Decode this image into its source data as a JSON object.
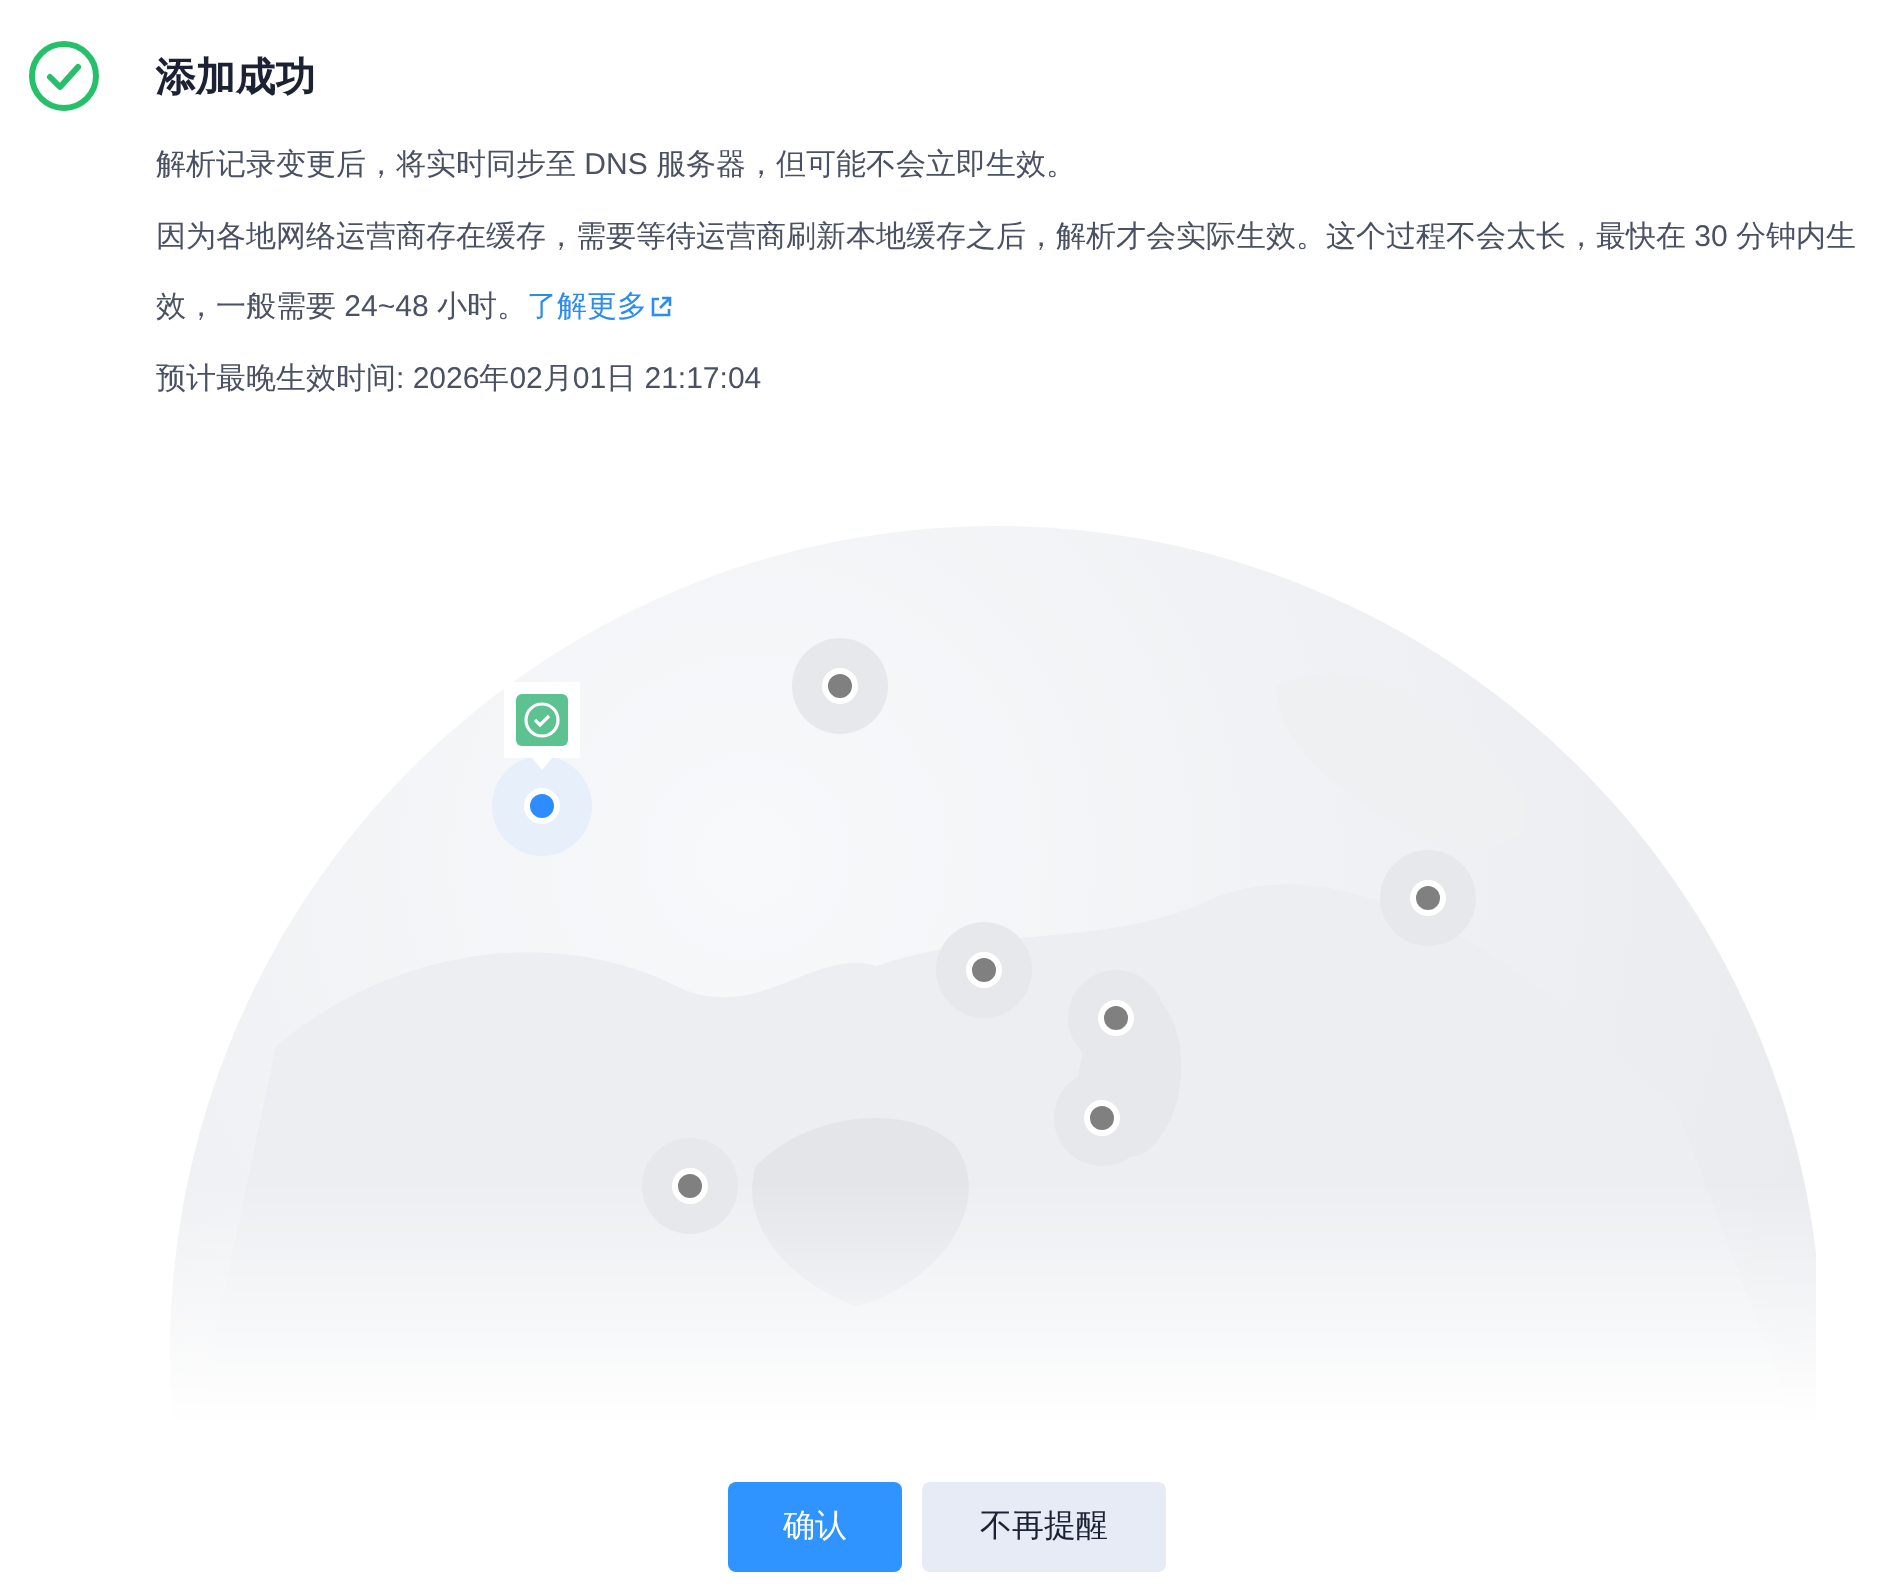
{
  "title": "添加成功",
  "notes": [
    {
      "text": "解析记录变更后，将实时同步至 DNS 服务器，但可能不会立即生效。"
    },
    {
      "text": "因为各地网络运营商存在缓存，需要等待运营商刷新本地缓存之后，解析才会实际生效。这个过程不会太长，最快在 30 分钟内生效，一般需要 24~48 小时。",
      "link": "了解更多"
    },
    {
      "text": "预计最晚生效时间: 2026年02月01日 21:17:04"
    }
  ],
  "buttons": [
    {
      "label": "确认",
      "kind": "primary"
    },
    {
      "label": "不再提醒",
      "kind": "secondary"
    }
  ]
}
